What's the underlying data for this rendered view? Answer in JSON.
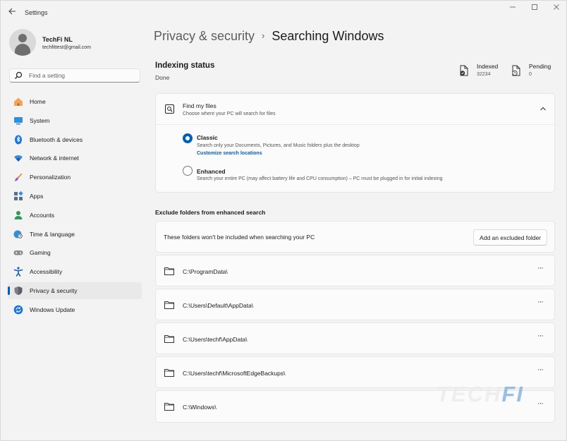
{
  "window": {
    "title": "Settings",
    "controls": [
      "minimize",
      "maximize",
      "close"
    ]
  },
  "profile": {
    "name": "TechFi NL",
    "email": "techfittest@gmail.com"
  },
  "search": {
    "placeholder": "Find a setting"
  },
  "sidebar": {
    "items": [
      {
        "label": "Home",
        "icon": "home-icon",
        "active": false
      },
      {
        "label": "System",
        "icon": "system-icon",
        "active": false
      },
      {
        "label": "Bluetooth & devices",
        "icon": "bluetooth-icon",
        "active": false
      },
      {
        "label": "Network & internet",
        "icon": "wifi-icon",
        "active": false
      },
      {
        "label": "Personalization",
        "icon": "brush-icon",
        "active": false
      },
      {
        "label": "Apps",
        "icon": "apps-icon",
        "active": false
      },
      {
        "label": "Accounts",
        "icon": "accounts-icon",
        "active": false
      },
      {
        "label": "Time & language",
        "icon": "globe-clock-icon",
        "active": false
      },
      {
        "label": "Gaming",
        "icon": "gamepad-icon",
        "active": false
      },
      {
        "label": "Accessibility",
        "icon": "accessibility-icon",
        "active": false
      },
      {
        "label": "Privacy & security",
        "icon": "shield-icon",
        "active": true
      },
      {
        "label": "Windows Update",
        "icon": "update-icon",
        "active": false
      }
    ]
  },
  "header": {
    "parent": "Privacy & security",
    "separator": "›",
    "current": "Searching Windows"
  },
  "indexing": {
    "title": "Indexing status",
    "status": "Done",
    "indexed_label": "Indexed",
    "indexed_value": "32234",
    "pending_label": "Pending",
    "pending_value": "0"
  },
  "find_my_files": {
    "title": "Find my files",
    "subtitle": "Choose where your PC will search for files",
    "expanded": true,
    "options": [
      {
        "label": "Classic",
        "description": "Search only your Documents, Pictures, and Music folders plus the desktop",
        "link": "Customize search locations",
        "selected": true
      },
      {
        "label": "Enhanced",
        "description": "Search your entire PC (may affect battery life and CPU consumption) – PC must be plugged in for initial indexing",
        "selected": false
      }
    ]
  },
  "exclude": {
    "section_title": "Exclude folders from enhanced search",
    "info_text": "These folders won't be included when searching your PC",
    "add_button": "Add an excluded folder",
    "more_label": "···",
    "folders": [
      "C:\\ProgramData\\",
      "C:\\Users\\Default\\AppData\\",
      "C:\\Users\\techf\\AppData\\",
      "C:\\Users\\techf\\MicrosoftEdgeBackups\\",
      "C:\\Windows\\"
    ]
  },
  "watermark": {
    "part_a": "TECH",
    "part_b": "FI"
  },
  "colors": {
    "accent": "#005fb8",
    "window_bg": "#f3f3f3",
    "card_bg": "#fbfbfb",
    "selected_nav_bg": "#e9e9e9"
  }
}
